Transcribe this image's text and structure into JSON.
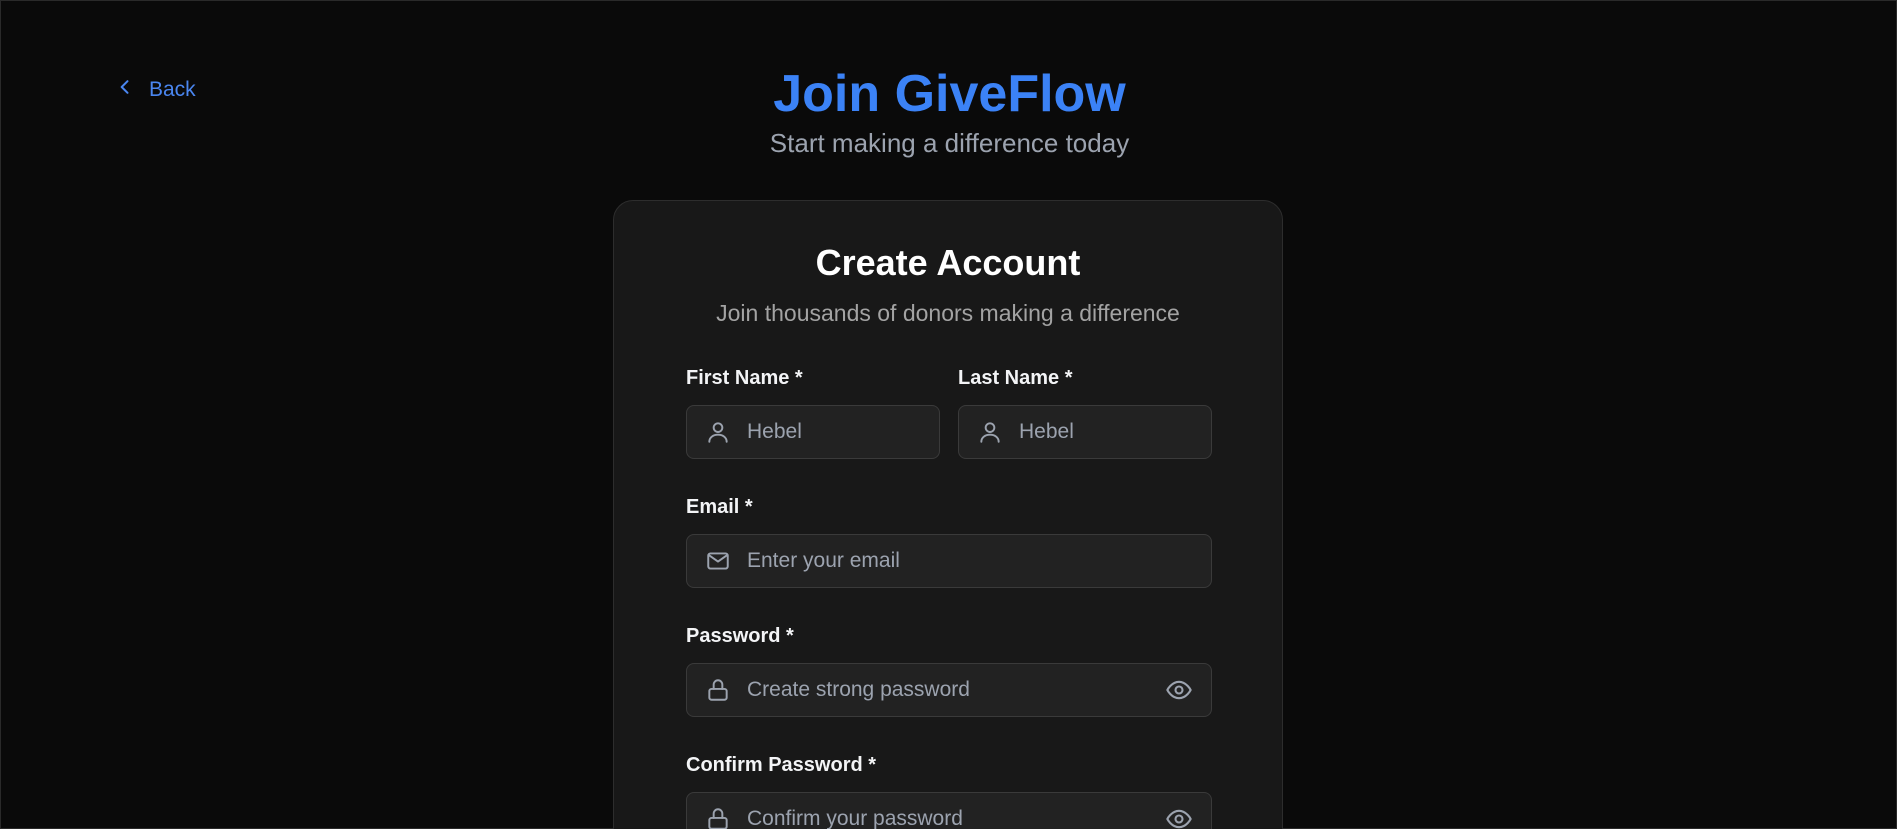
{
  "nav": {
    "back_label": "Back"
  },
  "header": {
    "title": "Join GiveFlow",
    "subtitle": "Start making a difference today"
  },
  "card": {
    "title": "Create Account",
    "subtitle": "Join thousands of donors making a difference"
  },
  "form": {
    "first_name": {
      "label": "First Name *",
      "placeholder": "Hebel",
      "icon": "user-icon"
    },
    "last_name": {
      "label": "Last Name *",
      "placeholder": "Hebel",
      "icon": "user-icon"
    },
    "email": {
      "label": "Email *",
      "placeholder": "Enter your email",
      "icon": "mail-icon"
    },
    "password": {
      "label": "Password *",
      "placeholder": "Create strong password",
      "icon": "lock-icon",
      "toggle_icon": "eye-icon"
    },
    "confirm_password": {
      "label": "Confirm Password *",
      "placeholder": "Confirm your password",
      "icon": "lock-icon",
      "toggle_icon": "eye-icon"
    }
  },
  "colors": {
    "accent": "#3b82f6",
    "background": "#0a0a0a",
    "card": "#181818",
    "input": "#222222"
  }
}
